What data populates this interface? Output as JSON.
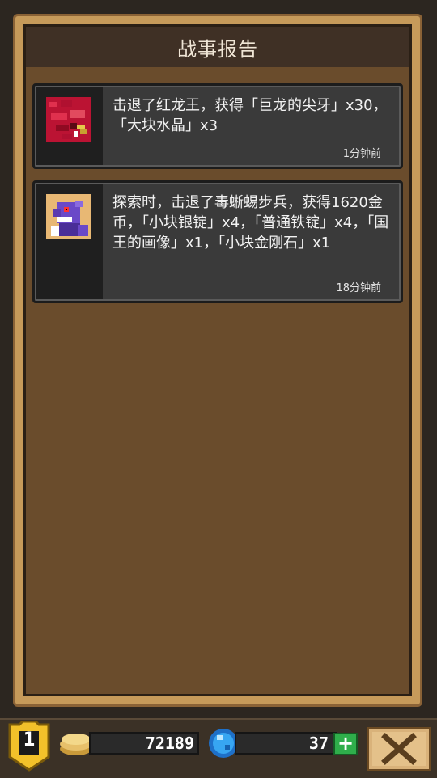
{
  "panel": {
    "title": "战事报告"
  },
  "reports": [
    {
      "icon": "red-dragon-fang-icon",
      "text": "击退了红龙王，获得「巨龙的尖牙」x30，「大块水晶」x3",
      "time": "1分钟前"
    },
    {
      "icon": "purple-lizard-soldier-icon",
      "text": "探索时，击退了毒蜥蜴步兵，获得1620金币，「小块银锭」x4，「普通铁锭」x4，「国王的画像」x1，「小块金刚石」x1",
      "time": "18分钟前"
    }
  ],
  "footer": {
    "level": "1",
    "coins": "72189",
    "gems": "37",
    "plus": "+",
    "close_icon": "close-x-icon"
  },
  "colors": {
    "frame_gold": "#c69a5a",
    "panel_brown": "#6a4c2c",
    "title_dark": "#3f3025",
    "card_gray": "#3a3a3a",
    "plus_green": "#2fae4b"
  }
}
